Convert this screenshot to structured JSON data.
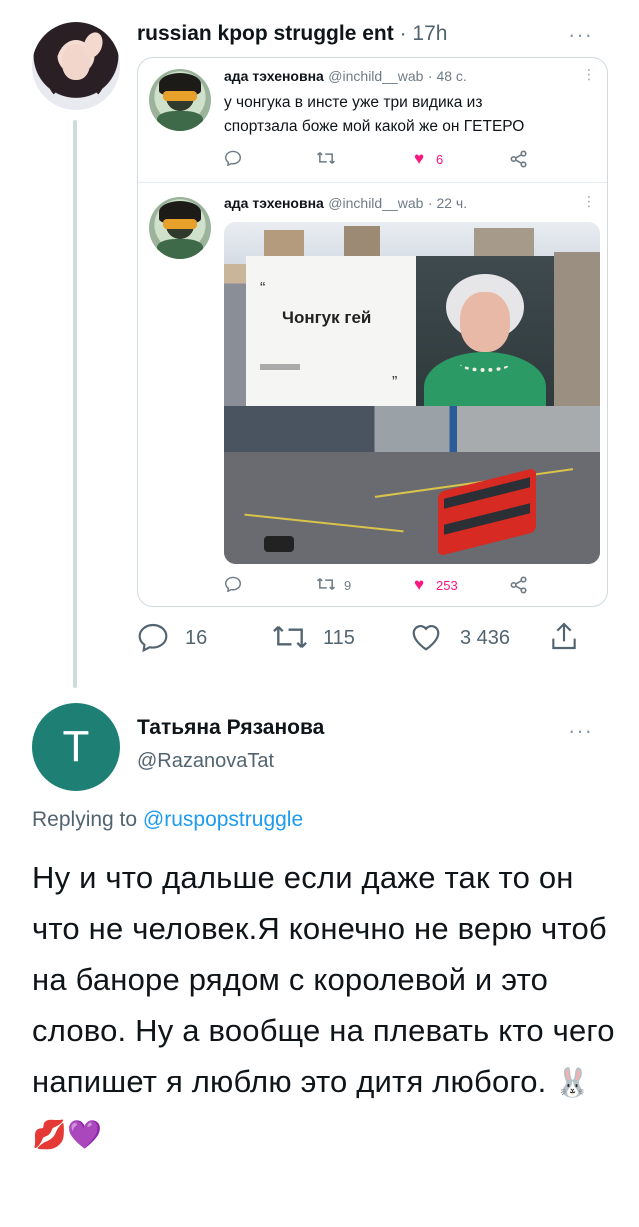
{
  "tweet": {
    "author_name": "russian kpop struggle ent",
    "time": "· 17h",
    "more": "···",
    "quote": {
      "first": {
        "author_name": "ада тэхеновна",
        "handle": "@inchild__wab",
        "time": "· 48 с.",
        "text_line1": "у чонгука в инсте уже три видика из",
        "text_line2": "спортзала боже мой какой же он ГЕТЕРО",
        "likes": "6"
      },
      "second": {
        "author_name": "ада тэхеновна",
        "handle": "@inchild__wab",
        "time": "· 22 ч.",
        "billboard_text": "Чонгук гей",
        "open_quote": "“",
        "close_quote": "”",
        "retweets": "9",
        "likes": "253"
      }
    },
    "stats": {
      "replies": "16",
      "retweets": "115",
      "likes": "3 436"
    }
  },
  "reply": {
    "avatar_letter": "T",
    "author_name": "Татьяна Рязанова",
    "handle": "@RazanovaTat",
    "more": "···",
    "replying_prefix": "Replying to ",
    "replying_to": "@ruspopstruggle",
    "text": "Ну и что дальше если даже так то он что не человек.Я конечно не верю чтоб на баноре рядом с королевой и это слово. Ну а вообще на плевать кто чего напишет я люблю это дитя любого.",
    "emojis": "🐰💋💜"
  },
  "colors": {
    "accent": "#1d9bf0",
    "like": "#f91880",
    "avatar_reply_bg": "#1e7f75"
  }
}
